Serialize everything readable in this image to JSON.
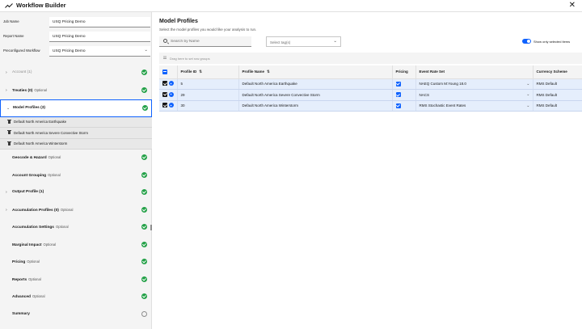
{
  "app": {
    "title": "Workflow Builder",
    "close_icon": "close-icon"
  },
  "left": {
    "fields": [
      {
        "label": "Job Name",
        "value": "USQ Pricing Demo",
        "type": "text"
      },
      {
        "label": "Report Name",
        "value": "USQ Pricing Demo",
        "type": "text"
      },
      {
        "label": "Preconfigured Workflow",
        "value": "USQ Pricing Demo",
        "type": "select"
      }
    ],
    "steps": [
      {
        "name": "Account (1)",
        "optional": "",
        "expander": "›",
        "dim": true,
        "status": "done"
      },
      {
        "name": "Treaties (0)",
        "optional": "Optional",
        "expander": "›",
        "dim": false,
        "status": "done"
      },
      {
        "name": "Model Profiles (3)",
        "optional": "",
        "expander": "⌄",
        "dim": false,
        "status": "done",
        "active": true,
        "items": [
          "Default North America Earthquake",
          "Default North America Severe Convective Storm",
          "Default North America Winterstorm"
        ]
      },
      {
        "name": "Geocode & Hazard",
        "optional": "Optional",
        "expander": "",
        "dim": false,
        "status": "done"
      },
      {
        "name": "Account Grouping",
        "optional": "Optional",
        "expander": "",
        "dim": false,
        "status": "done"
      },
      {
        "name": "Output Profile (1)",
        "optional": "",
        "expander": "›",
        "dim": false,
        "status": "done"
      },
      {
        "name": "Accumulation Profiles (0)",
        "optional": "Optional",
        "expander": "›",
        "dim": false,
        "status": "done"
      },
      {
        "name": "Accumulation Settings",
        "optional": "Optional",
        "expander": "",
        "dim": false,
        "status": "done"
      },
      {
        "name": "Marginal Impact",
        "optional": "Optional",
        "expander": "",
        "dim": false,
        "status": "done"
      },
      {
        "name": "Pricing",
        "optional": "Optional",
        "expander": "",
        "dim": false,
        "status": "done"
      },
      {
        "name": "Reports",
        "optional": "Optional",
        "expander": "",
        "dim": false,
        "status": "done"
      },
      {
        "name": "Advanced",
        "optional": "Optional",
        "expander": "",
        "dim": false,
        "status": "done"
      },
      {
        "name": "Summary",
        "optional": "",
        "expander": "",
        "dim": false,
        "status": "pending"
      }
    ]
  },
  "main": {
    "title": "Model Profiles",
    "description": "Select the model profiles you would like your analysis to run.",
    "search": {
      "placeholder": "Search by Name"
    },
    "tags": {
      "placeholder": "Select tag(s)"
    },
    "toggle": {
      "label": "Show only selected items",
      "on": true
    },
    "group_hint": "Drag here to set row groups",
    "columns": [
      "",
      "Profile ID",
      "Profile Name",
      "Pricing",
      "Event Rate Set",
      "Currency Scheme"
    ],
    "rows": [
      {
        "id": "5",
        "name": "Default North America Earthquake",
        "pricing": true,
        "event_rate_set": "NAEQ Custom M:Young 18.0",
        "currency": "RMS Default"
      },
      {
        "id": "29",
        "name": "Default North America Severe Convective Storm",
        "pricing": true,
        "event_rate_set": "NACS",
        "currency": "RMS Default"
      },
      {
        "id": "30",
        "name": "Default North America Winterstorm",
        "pricing": true,
        "event_rate_set": "RMS Stochastic Event Rates",
        "currency": "RMS Default"
      }
    ]
  },
  "colors": {
    "accent": "#0f62fe",
    "success": "#24a148",
    "selected_row": "#e5eefc"
  }
}
